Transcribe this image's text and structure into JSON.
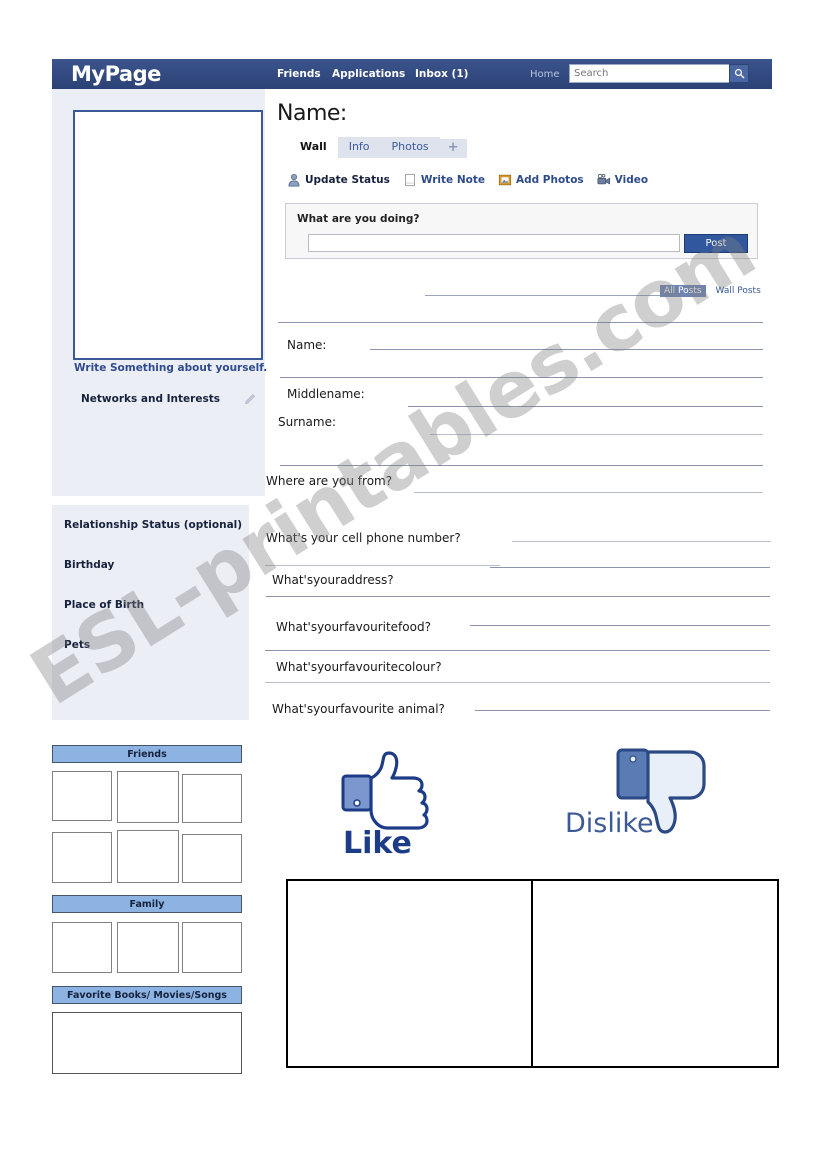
{
  "watermark": {
    "text": "ESL-printables.com"
  },
  "header": {
    "brand": "MyPage",
    "nav": [
      {
        "label": "Friends"
      },
      {
        "label": "Applications"
      },
      {
        "label": "Inbox (1)"
      },
      {
        "label": "Home"
      }
    ],
    "search": {
      "placeholder": "Search",
      "value": "",
      "icon": "search-icon"
    }
  },
  "sidebar": {
    "write_something": "Write Something about yourself.",
    "networks_title": "Networks and Interests",
    "edit_icon": "pencil-icon",
    "about_items": [
      "Relationship Status (optional)",
      "Birthday",
      "Place of Birth",
      "Pets"
    ],
    "friends_header": "Friends",
    "family_header": "Family",
    "favorites_header": "Favorite Books/ Movies/Songs"
  },
  "main": {
    "page_title": "Name:",
    "tabs": [
      {
        "label": "Wall",
        "active": true
      },
      {
        "label": "Info",
        "active": false
      },
      {
        "label": "Photos",
        "active": false
      },
      {
        "label": "+",
        "active": false
      }
    ],
    "actions": [
      {
        "label": "Update Status",
        "icon": "person-icon"
      },
      {
        "label": "Write Note",
        "icon": "note-icon"
      },
      {
        "label": "Add Photos",
        "icon": "photo-icon"
      },
      {
        "label": "Video",
        "icon": "video-camera-icon"
      }
    ],
    "status": {
      "prompt": "What are you doing?",
      "input_value": "",
      "input_placeholder": "",
      "post_label": "Post"
    },
    "post_filters": [
      {
        "label": "All Posts",
        "selected": true
      },
      {
        "label": "Wall Posts",
        "selected": false
      }
    ],
    "questions": [
      {
        "label": "Name:"
      },
      {
        "label": "Middlename:"
      },
      {
        "label": "Surname:"
      },
      {
        "label": "Where are you from?"
      },
      {
        "label": "What's your cell phone number?"
      },
      {
        "label": "What'syouraddress?"
      },
      {
        "label": "What'syourfavouritefood?"
      },
      {
        "label": "What'syourfavouritecolour?"
      },
      {
        "label": "What'syourfavourite animal?"
      }
    ],
    "reactions": {
      "like_label": "Like",
      "dislike_label": "Dislike",
      "like_icon": "thumbs-up-icon",
      "dislike_icon": "thumbs-down-icon"
    }
  },
  "colors": {
    "header_blue": "#30497f",
    "link_blue": "#3b5998",
    "tab_inactive": "#dfe3ee",
    "panel_gray": "#eceef5",
    "grid_header_blue": "#8db3e2",
    "post_button": "#31589e"
  }
}
